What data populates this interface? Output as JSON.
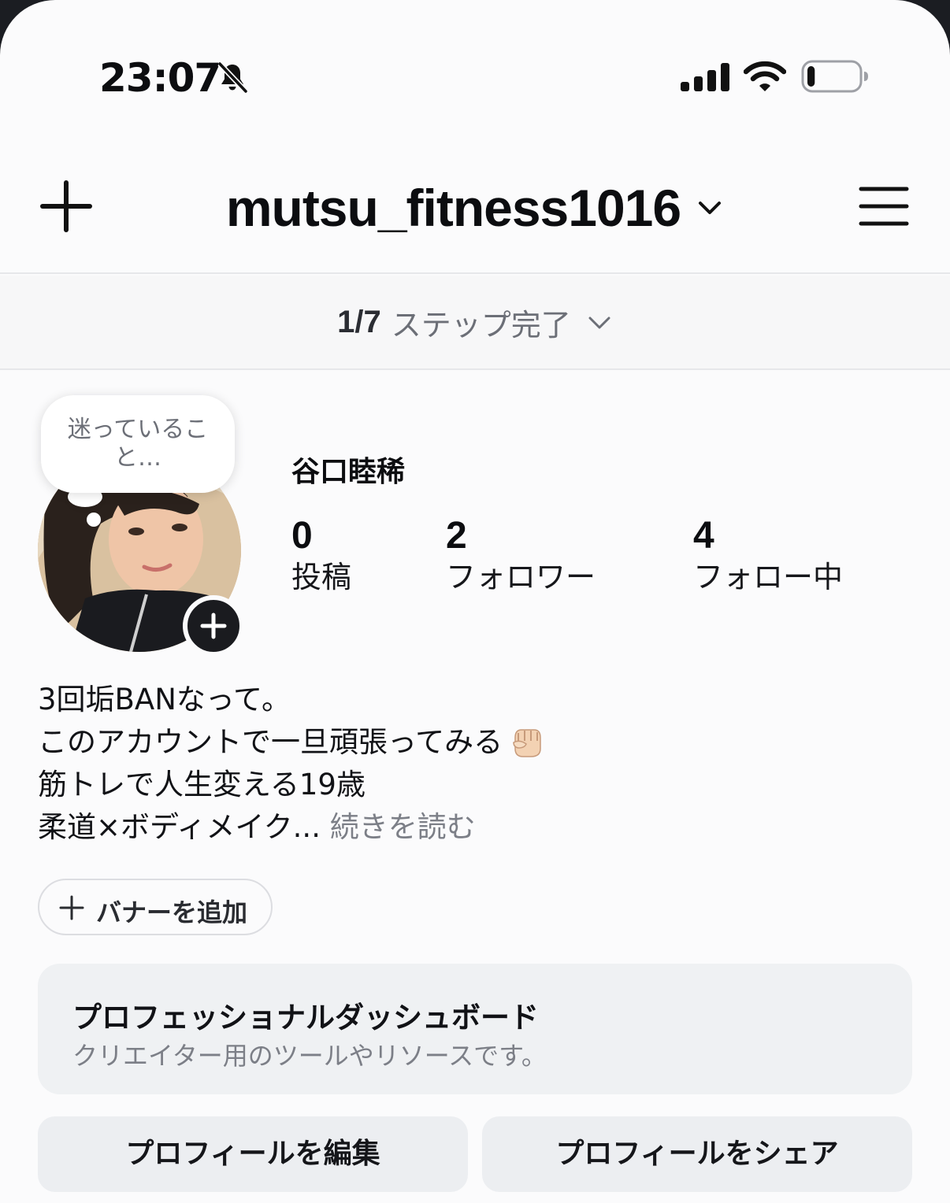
{
  "status_bar": {
    "time": "23:07",
    "silent_icon": "bell-slash-icon",
    "signal_icon": "cellular-signal-icon",
    "wifi_icon": "wifi-icon",
    "battery_icon": "battery-icon",
    "battery_level": 0.15
  },
  "header": {
    "username": "mutsu_fitness1016",
    "new_icon": "plus-icon",
    "switch_icon": "chevron-down-icon",
    "menu_icon": "hamburger-menu-icon"
  },
  "steps": {
    "count": "1/7",
    "label": "ステップ完了"
  },
  "profile": {
    "note": "迷っていること…",
    "display_name": "谷口睦稀",
    "stats": [
      {
        "value": "0",
        "label": "投稿"
      },
      {
        "value": "2",
        "label": "フォロワー"
      },
      {
        "value": "4",
        "label": "フォロー中"
      }
    ]
  },
  "bio": {
    "line1": "3回垢BANなって。",
    "line2": "このアカウントで一旦頑張ってみる",
    "line2_emoji": "raised-fist-icon",
    "line3": "筋トレで人生変える19歳",
    "line4": "柔道×ボディメイク...",
    "more": "続きを読む"
  },
  "banner": {
    "label": "バナーを追加"
  },
  "dashboard": {
    "title": "プロフェッショナルダッシュボード",
    "subtitle": "クリエイター用のツールやリソースです。"
  },
  "actions": {
    "edit": "プロフィールを編集",
    "share": "プロフィールをシェア"
  },
  "colors": {
    "background": "#fbfbfc",
    "text": "#0c0d10",
    "secondary_text": "#7c7f87",
    "card": "#eff1f3"
  }
}
